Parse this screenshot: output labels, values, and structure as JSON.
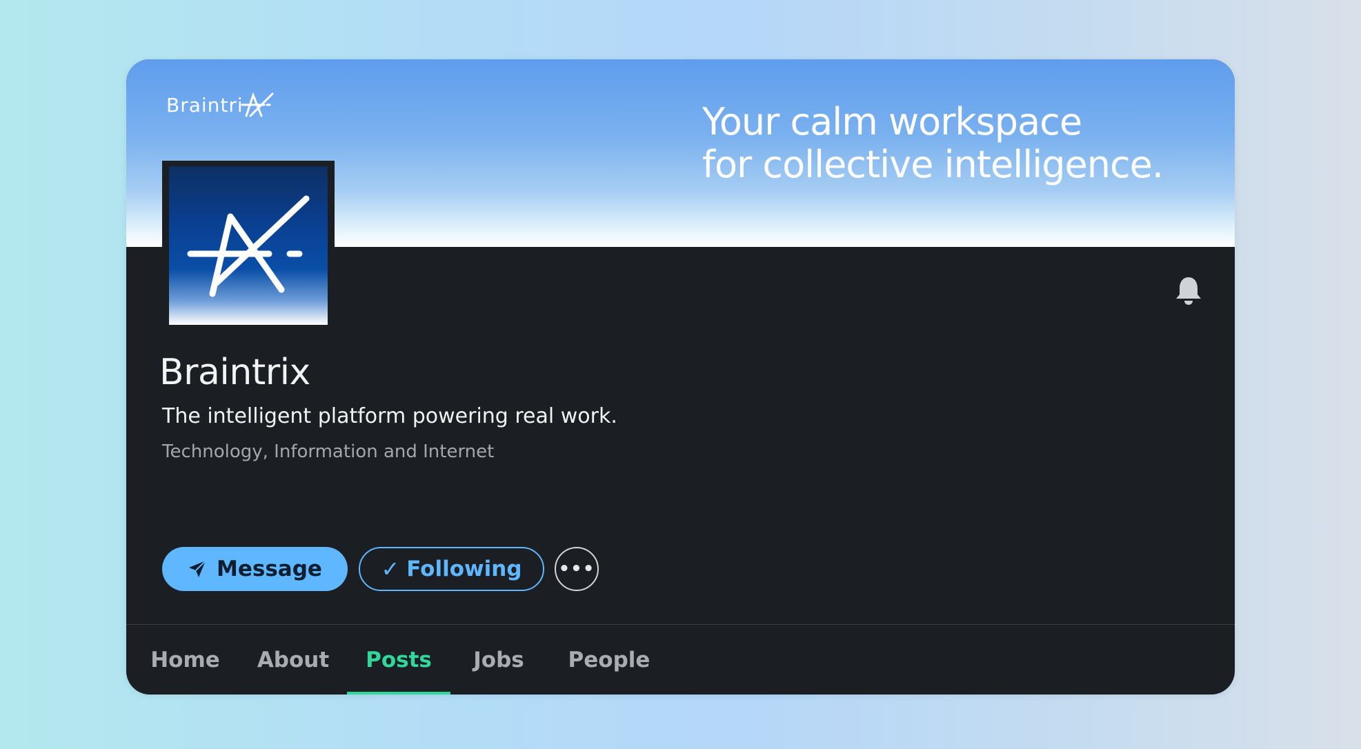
{
  "cover": {
    "logo_text": "Braintri",
    "tagline_line1": "Your calm workspace",
    "tagline_line2": "for collective intelligence."
  },
  "company": {
    "name": "Braintrix",
    "description": "The intelligent platform powering real work.",
    "industry": "Technology, Information and Internet"
  },
  "actions": {
    "message_label": "Message",
    "following_label": "Following",
    "following_check": "✓",
    "more_label": "•••"
  },
  "tabs": [
    {
      "label": "Home"
    },
    {
      "label": "About"
    },
    {
      "label": "Posts",
      "active": true
    },
    {
      "label": "Jobs"
    },
    {
      "label": "People"
    }
  ],
  "colors": {
    "accent_blue": "#5fb7ff",
    "active_tab_green": "#2fd89a",
    "card_background": "#1b1f23"
  },
  "icons": {
    "bell": "bell-icon",
    "send": "send-icon",
    "logo_mark": "braintrix-x-mark-icon"
  }
}
